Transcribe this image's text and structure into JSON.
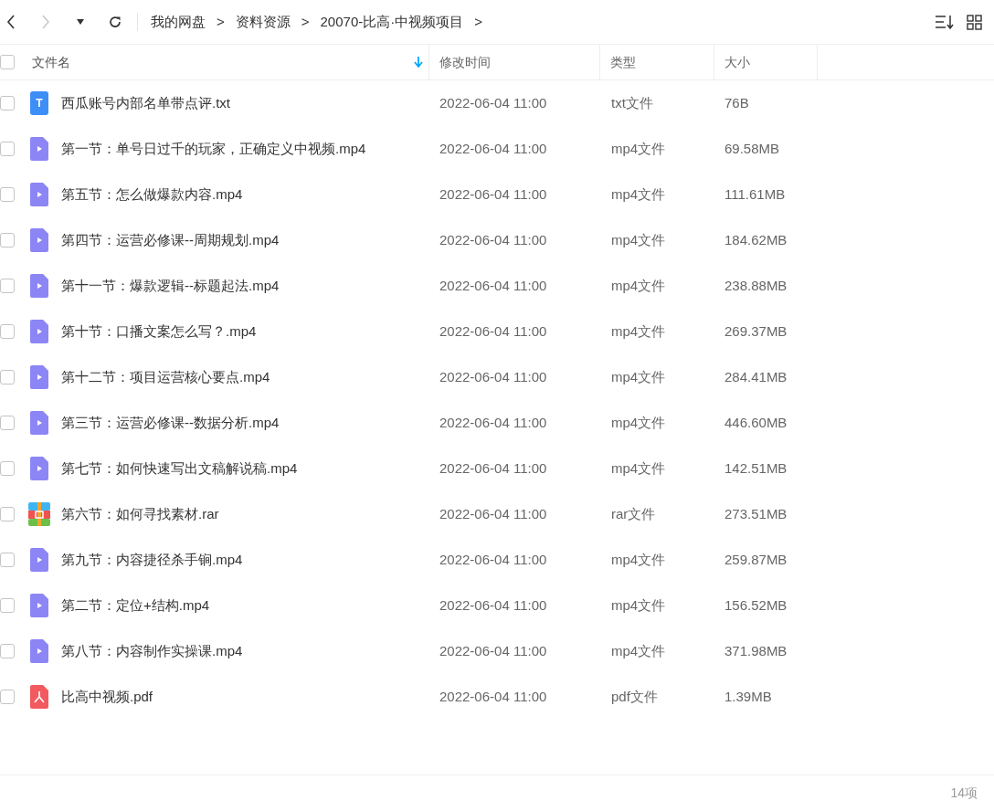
{
  "nav": [
    {
      "kind": "back",
      "disabled": false
    },
    {
      "kind": "forward",
      "disabled": true
    },
    {
      "kind": "history",
      "disabled": false
    },
    {
      "kind": "refresh",
      "disabled": false
    }
  ],
  "breadcrumb": [
    "我的网盘",
    "资料资源",
    "20070-比高·中视频项目"
  ],
  "breadcrumb_separator": ">",
  "select_all_checked": false,
  "columns": [
    {
      "label": "文件名",
      "sorted": true
    },
    {
      "label": "修改时间",
      "sorted": false
    },
    {
      "label": "类型",
      "sorted": false
    },
    {
      "label": "大小",
      "sorted": false
    }
  ],
  "rows": [
    {
      "kind": "txt",
      "checked": false,
      "name": "西瓜账号内部名单带点评.txt",
      "modified": "2022-06-04 11:00",
      "type": "txt文件",
      "size": "76B",
      "icon_letter": "T"
    },
    {
      "kind": "video",
      "checked": false,
      "name": "第一节：单号日过千的玩家，正确定义中视频.mp4",
      "modified": "2022-06-04 11:00",
      "type": "mp4文件",
      "size": "69.58MB"
    },
    {
      "kind": "video",
      "checked": false,
      "name": "第五节：怎么做爆款内容.mp4",
      "modified": "2022-06-04 11:00",
      "type": "mp4文件",
      "size": "111.61MB"
    },
    {
      "kind": "video",
      "checked": false,
      "name": "第四节：运营必修课--周期规划.mp4",
      "modified": "2022-06-04 11:00",
      "type": "mp4文件",
      "size": "184.62MB"
    },
    {
      "kind": "video",
      "checked": false,
      "name": "第十一节：爆款逻辑--标题起法.mp4",
      "modified": "2022-06-04 11:00",
      "type": "mp4文件",
      "size": "238.88MB"
    },
    {
      "kind": "video",
      "checked": false,
      "name": "第十节：口播文案怎么写？.mp4",
      "modified": "2022-06-04 11:00",
      "type": "mp4文件",
      "size": "269.37MB"
    },
    {
      "kind": "video",
      "checked": false,
      "name": "第十二节：项目运营核心要点.mp4",
      "modified": "2022-06-04 11:00",
      "type": "mp4文件",
      "size": "284.41MB"
    },
    {
      "kind": "video",
      "checked": false,
      "name": "第三节：运营必修课--数据分析.mp4",
      "modified": "2022-06-04 11:00",
      "type": "mp4文件",
      "size": "446.60MB"
    },
    {
      "kind": "video",
      "checked": false,
      "name": "第七节：如何快速写出文稿解说稿.mp4",
      "modified": "2022-06-04 11:00",
      "type": "mp4文件",
      "size": "142.51MB"
    },
    {
      "kind": "archive",
      "checked": false,
      "name": "第六节：如何寻找素材.rar",
      "modified": "2022-06-04 11:00",
      "type": "rar文件",
      "size": "273.51MB"
    },
    {
      "kind": "video",
      "checked": false,
      "name": "第九节：内容捷径杀手锏.mp4",
      "modified": "2022-06-04 11:00",
      "type": "mp4文件",
      "size": "259.87MB"
    },
    {
      "kind": "video",
      "checked": false,
      "name": "第二节：定位+结构.mp4",
      "modified": "2022-06-04 11:00",
      "type": "mp4文件",
      "size": "156.52MB"
    },
    {
      "kind": "video",
      "checked": false,
      "name": "第八节：内容制作实操课.mp4",
      "modified": "2022-06-04 11:00",
      "type": "mp4文件",
      "size": "371.98MB"
    },
    {
      "kind": "pdf",
      "checked": false,
      "name": "比高中视频.pdf",
      "modified": "2022-06-04 11:00",
      "type": "pdf文件",
      "size": "1.39MB"
    }
  ],
  "status_bar": {
    "count": "14项"
  }
}
